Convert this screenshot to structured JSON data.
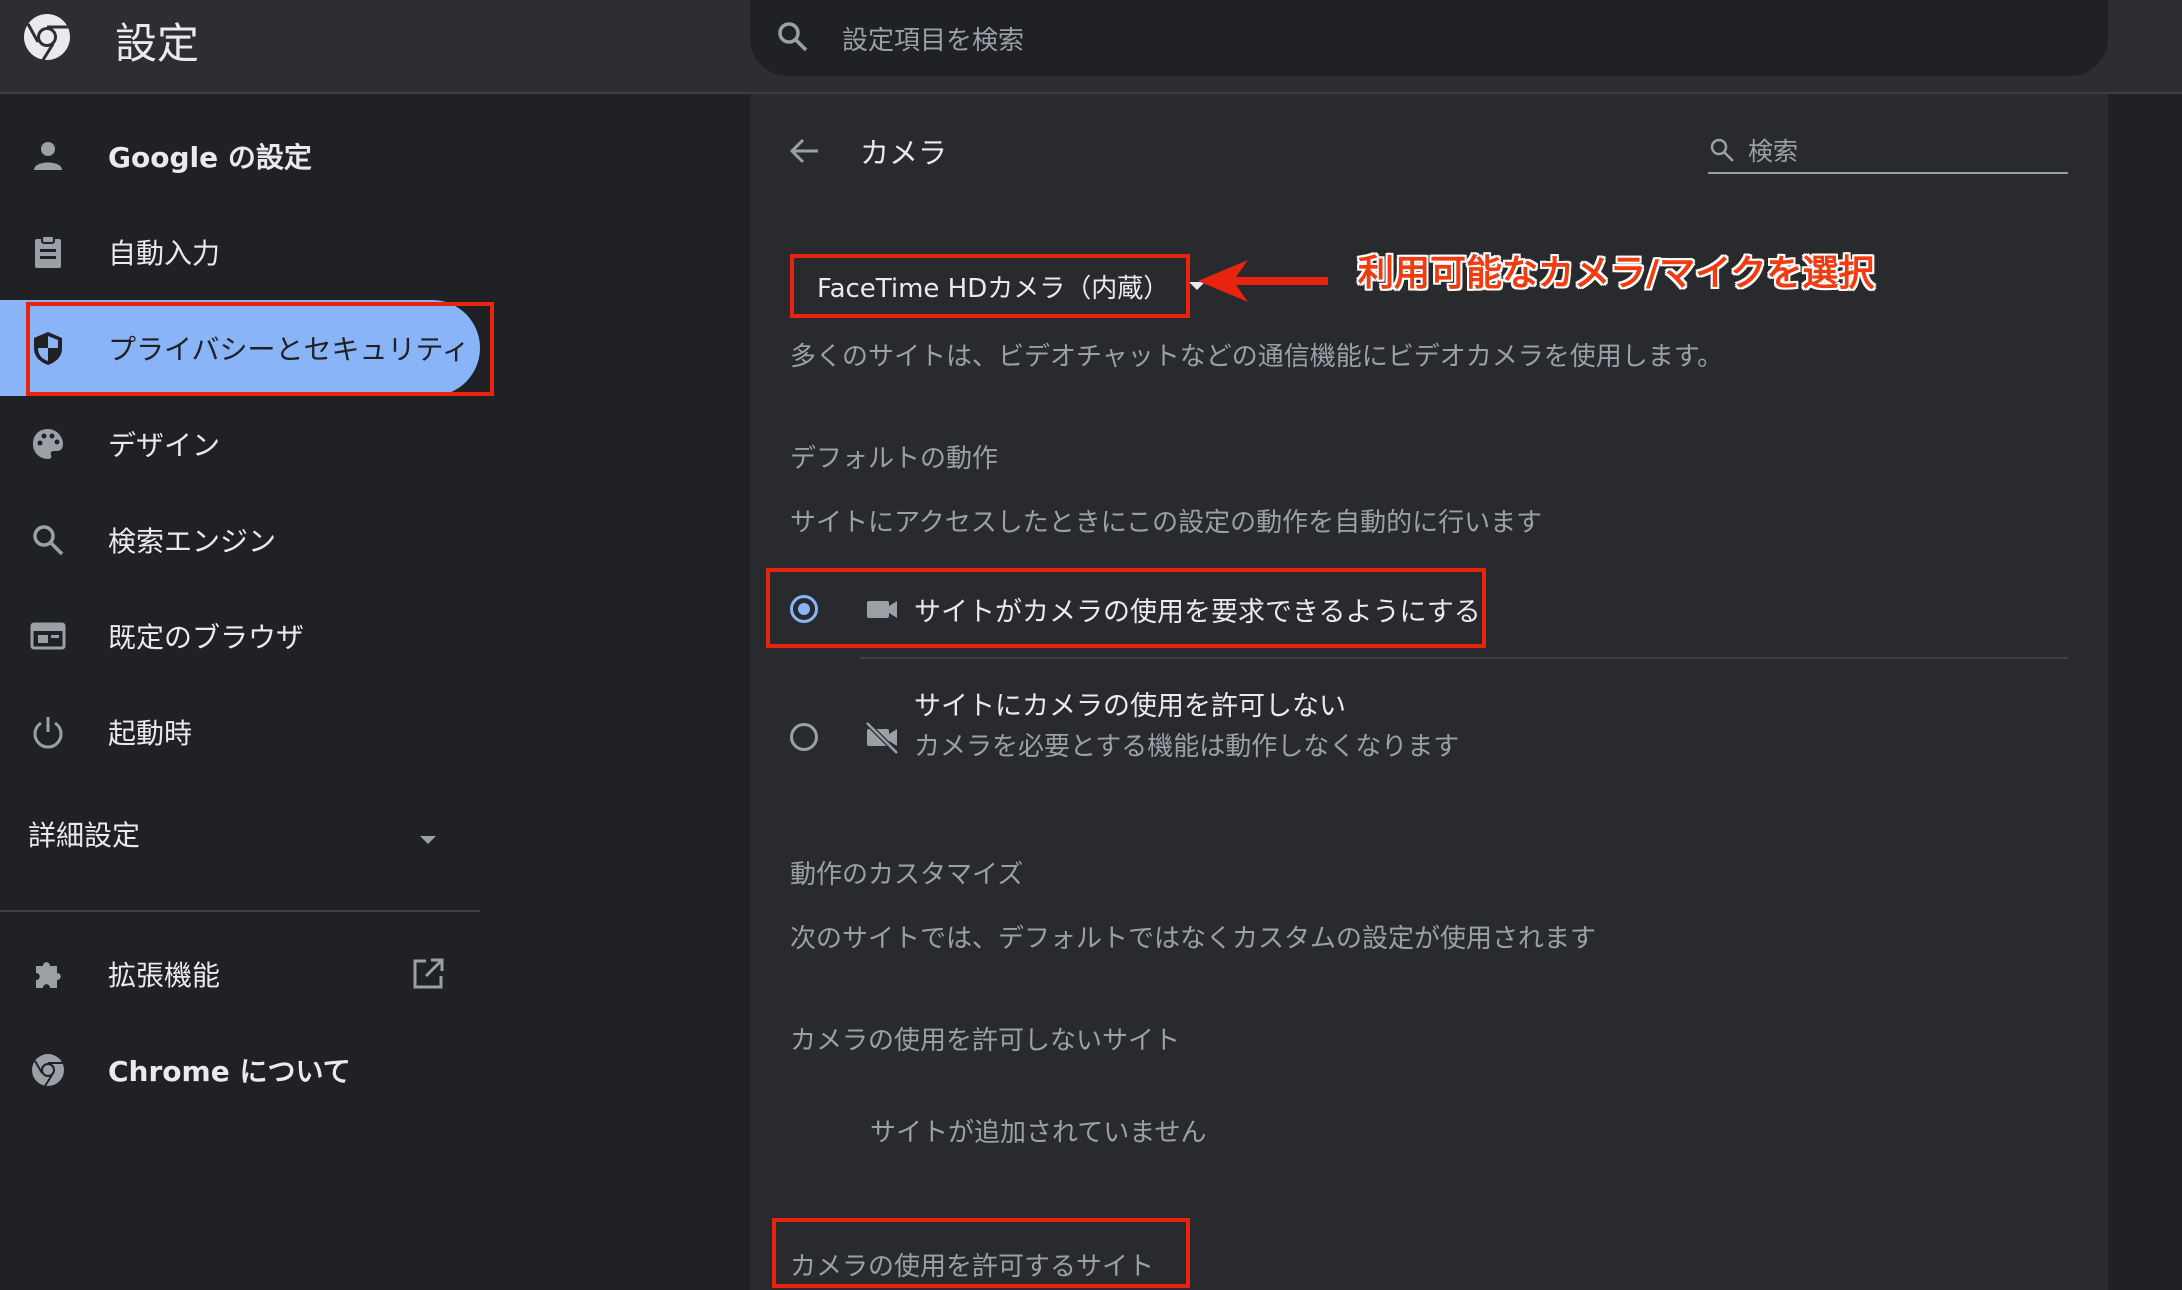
{
  "header": {
    "title": "設定",
    "search_placeholder": "設定項目を検索"
  },
  "sidebar": {
    "items": [
      {
        "label": "Google の設定",
        "icon": "person-icon"
      },
      {
        "label": "自動入力",
        "icon": "clipboard-icon"
      },
      {
        "label": "プライバシーとセキュリティ",
        "icon": "shield-icon"
      },
      {
        "label": "デザイン",
        "icon": "palette-icon"
      },
      {
        "label": "検索エンジン",
        "icon": "search-icon"
      },
      {
        "label": "既定のブラウザ",
        "icon": "browser-icon"
      },
      {
        "label": "起動時",
        "icon": "power-icon"
      }
    ],
    "selected_index": 2,
    "advanced_label": "詳細設定",
    "extensions_label": "拡張機能",
    "about_label": "Chrome について"
  },
  "main": {
    "title": "カメラ",
    "search_placeholder": "検索",
    "device_select": "FaceTime HDカメラ（内蔵）",
    "device_description": "多くのサイトは、ビデオチャットなどの通信機能にビデオカメラを使用します。",
    "default_behavior": {
      "title": "デフォルトの動作",
      "description": "サイトにアクセスしたときにこの設定の動作を自動的に行います",
      "options": [
        {
          "label": "サイトがカメラの使用を要求できるようにする",
          "checked": true,
          "icon": "videocam-icon"
        },
        {
          "label": "サイトにカメラの使用を許可しない",
          "sublabel": "カメラを必要とする機能は動作しなくなります",
          "checked": false,
          "icon": "videocam-off-icon"
        }
      ]
    },
    "custom_behavior": {
      "title": "動作のカスタマイズ",
      "description": "次のサイトでは、デフォルトではなくカスタムの設定が使用されます"
    },
    "blocked_sites": {
      "title": "カメラの使用を許可しないサイト",
      "empty_message": "サイトが追加されていません"
    },
    "allowed_sites": {
      "title": "カメラの使用を許可するサイト"
    }
  },
  "annotation": {
    "text": "利用可能なカメラ/マイクを選択",
    "color": "#e8240e"
  },
  "colors": {
    "background": "#202124",
    "card": "#292a2d",
    "accent": "#8ab4f8"
  }
}
